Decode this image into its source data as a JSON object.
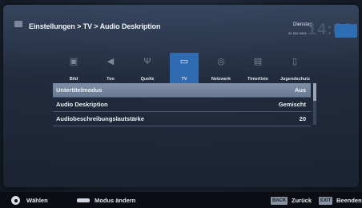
{
  "header": {
    "breadcrumb": "Einstellungen > TV > Audio Deskription",
    "day": "Dienstag",
    "date": "xx xxx xxxx",
    "time": "14:00"
  },
  "tabs": [
    {
      "label": "Bild",
      "icon": "picture-icon",
      "glyph": "▣"
    },
    {
      "label": "Ton",
      "icon": "speaker-icon",
      "glyph": "◀"
    },
    {
      "label": "Quelle",
      "icon": "antenna-icon",
      "glyph": "Ψ"
    },
    {
      "label": "TV",
      "icon": "tv-icon",
      "glyph": "▭"
    },
    {
      "label": "Netzwerk",
      "icon": "globe-icon",
      "glyph": "◎"
    },
    {
      "label": "Timerliste",
      "icon": "timer-icon",
      "glyph": "▤"
    },
    {
      "label": "Jugendschutz",
      "icon": "lock-icon",
      "glyph": "▯"
    }
  ],
  "active_tab": "TV",
  "menu": [
    {
      "label": "Untertitelmodus",
      "value": "Aus",
      "selected": true
    },
    {
      "label": "Audio Deskription",
      "value": "Gemischt",
      "selected": false
    },
    {
      "label": "Audiobeschreibungslautstärke",
      "value": "20",
      "selected": false
    }
  ],
  "footer": {
    "select": "Wählen",
    "mode": "Modus ändern",
    "back_key": "BACK",
    "back": "Zurück",
    "exit_key": "EXIT",
    "exit": "Beenden"
  }
}
